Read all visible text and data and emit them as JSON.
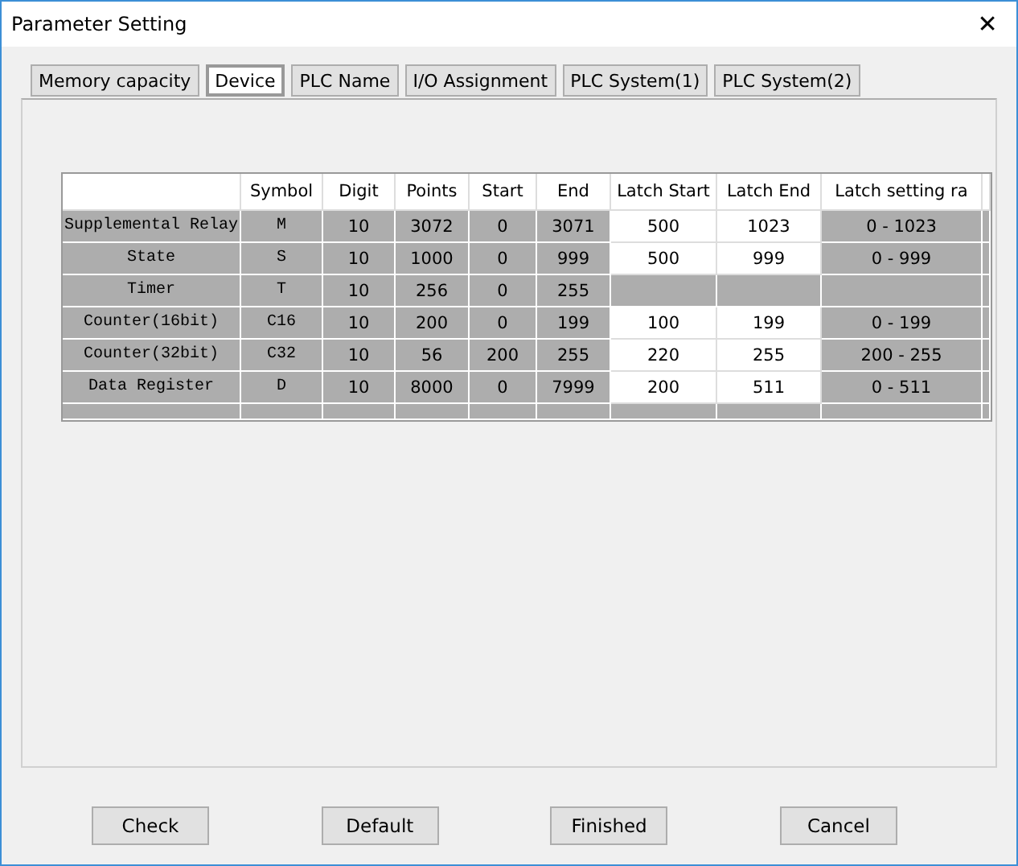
{
  "window": {
    "title": "Parameter Setting",
    "close": "✕"
  },
  "tabs": [
    {
      "label": "Memory capacity",
      "selected": false
    },
    {
      "label": "Device",
      "selected": true
    },
    {
      "label": "PLC Name",
      "selected": false
    },
    {
      "label": "I/O Assignment",
      "selected": false
    },
    {
      "label": "PLC System(1)",
      "selected": false
    },
    {
      "label": "PLC System(2)",
      "selected": false
    }
  ],
  "table": {
    "columns": [
      "Symbol",
      "Digit",
      "Points",
      "Start",
      "End",
      "Latch Start",
      "Latch End",
      "Latch setting ra"
    ],
    "rows": [
      {
        "name": "Supplemental Relay",
        "cells": [
          "M",
          "10",
          "3072",
          "0",
          "3071",
          "500",
          "1023",
          "0 - 1023"
        ],
        "latch_editable": true
      },
      {
        "name": "State",
        "cells": [
          "S",
          "10",
          "1000",
          "0",
          "999",
          "500",
          "999",
          "0 - 999"
        ],
        "latch_editable": true
      },
      {
        "name": "Timer",
        "cells": [
          "T",
          "10",
          "256",
          "0",
          "255"
        ],
        "latch_editable": false
      },
      {
        "name": "Counter(16bit)",
        "cells": [
          "C16",
          "10",
          "200",
          "0",
          "199",
          "100",
          "199",
          "0 - 199"
        ],
        "latch_editable": true
      },
      {
        "name": "Counter(32bit)",
        "cells": [
          "C32",
          "10",
          "56",
          "200",
          "255",
          "220",
          "255",
          "200 - 255"
        ],
        "latch_editable": true
      },
      {
        "name": "Data Register",
        "cells": [
          "D",
          "10",
          "8000",
          "0",
          "7999",
          "200",
          "511",
          "0 - 511"
        ],
        "latch_editable": true
      }
    ]
  },
  "buttons": [
    "Check",
    "Default",
    "Finished",
    "Cancel"
  ]
}
